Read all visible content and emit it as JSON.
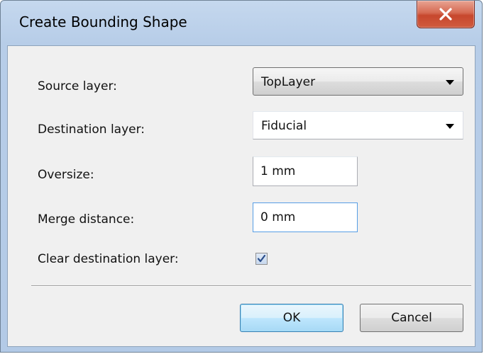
{
  "window": {
    "title": "Create Bounding Shape"
  },
  "form": {
    "source_layer": {
      "label": "Source layer:",
      "value": "TopLayer"
    },
    "destination_layer": {
      "label": "Destination layer:",
      "value": "Fiducial"
    },
    "oversize": {
      "label": "Oversize:",
      "value": "1 mm"
    },
    "merge_distance": {
      "label": "Merge distance:",
      "value": "0 mm"
    },
    "clear_destination": {
      "label": "Clear destination layer:",
      "checked": true
    }
  },
  "buttons": {
    "ok": "OK",
    "cancel": "Cancel"
  },
  "colors": {
    "title_bar": "#b7cde8",
    "close_button": "#c7472d",
    "dialog_background": "#f0f0f0",
    "focus_border": "#569de5",
    "default_button": "#bee6fd"
  }
}
